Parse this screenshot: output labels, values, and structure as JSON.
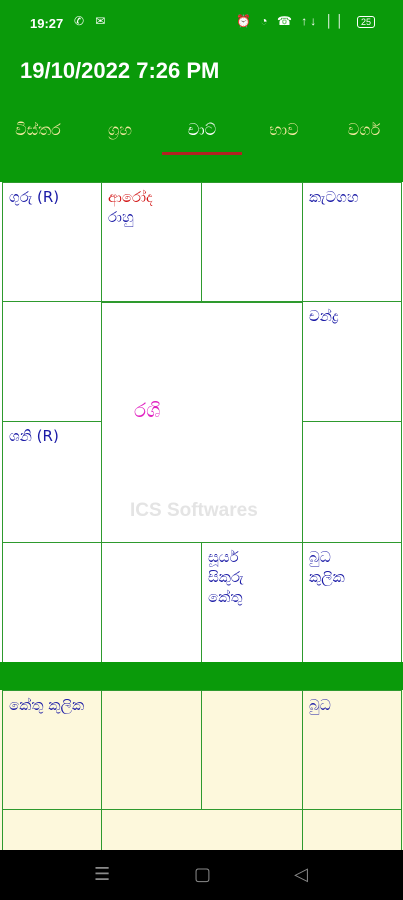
{
  "status": {
    "time": "19:27",
    "left_icons": "✆ ✉",
    "right_icons": "⏰ ◔ ☎ ↑↓ ││",
    "battery": "25"
  },
  "app": {
    "title": "19/10/2022 7:26 PM",
    "tabs": [
      "විස්තර",
      "ග්‍රහ",
      "චාට්",
      "භාව",
      "වර්ග"
    ],
    "active_tab": "චාට්"
  },
  "chart": {
    "rashi_label": "රශි",
    "watermark": "ICS Softwares",
    "cells": {
      "r0c0": [
        "ගුරු (R)"
      ],
      "r0c1": [
        "ආරෝද",
        "රාහු"
      ],
      "r0c2": [],
      "r0c3": [
        "කැටගහ"
      ],
      "r1c0": [],
      "r1c3": [
        "චන්ද්‍ර"
      ],
      "r2c0": [
        "ශනි (R)"
      ],
      "r2c3": [],
      "r3c0": [],
      "r3c1": [],
      "r3c2": [
        "සූර්ය",
        "සිකුරු",
        "කේතු"
      ],
      "r3c3": [
        "බුධ",
        "කුලික"
      ]
    }
  },
  "navamsa": {
    "cells": {
      "r0c0": [
        "කේතු",
        "කුලික"
      ],
      "r0c3": [
        "බුධ"
      ]
    }
  },
  "colors": {
    "green": "#0a9a0a",
    "tab_inactive": "#f3e9a0",
    "indicator": "#b22222",
    "planet_blue": "#1a1aa6",
    "planet_red": "#d11212",
    "rashi_magenta": "#e023c0"
  },
  "navbar": {
    "recents": "☰",
    "home": "▢",
    "back": "◁"
  }
}
